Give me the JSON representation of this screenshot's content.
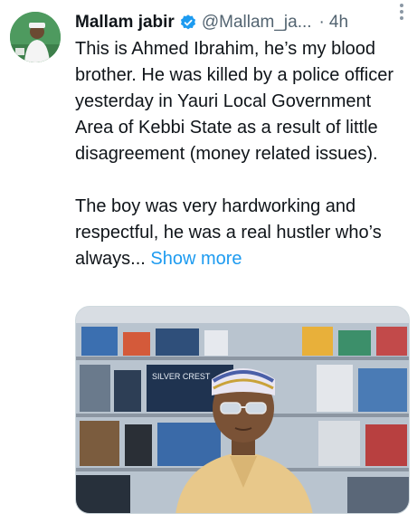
{
  "tweet": {
    "display_name": "Mallam jabir",
    "handle": "@Mallam_ja...",
    "separator": "·",
    "timestamp": "4h",
    "paragraph1": "This is Ahmed Ibrahim, he’s my blood brother. He was killed by a police officer yesterday in Yauri Local Government Area of Kebbi State as a result of little disagreement (money related issues).",
    "paragraph2": "The boy was very hardworking and respectful, he was a real hustler who’s always...",
    "show_more": "Show more",
    "media_product_text": "SILVER CREST"
  },
  "icons": {
    "verified": "verified-badge-icon",
    "more": "more-options-icon"
  },
  "colors": {
    "link": "#1d9bf0",
    "verified": "#1d9bf0",
    "secondary_text": "#536471",
    "primary_text": "#0f1419"
  }
}
